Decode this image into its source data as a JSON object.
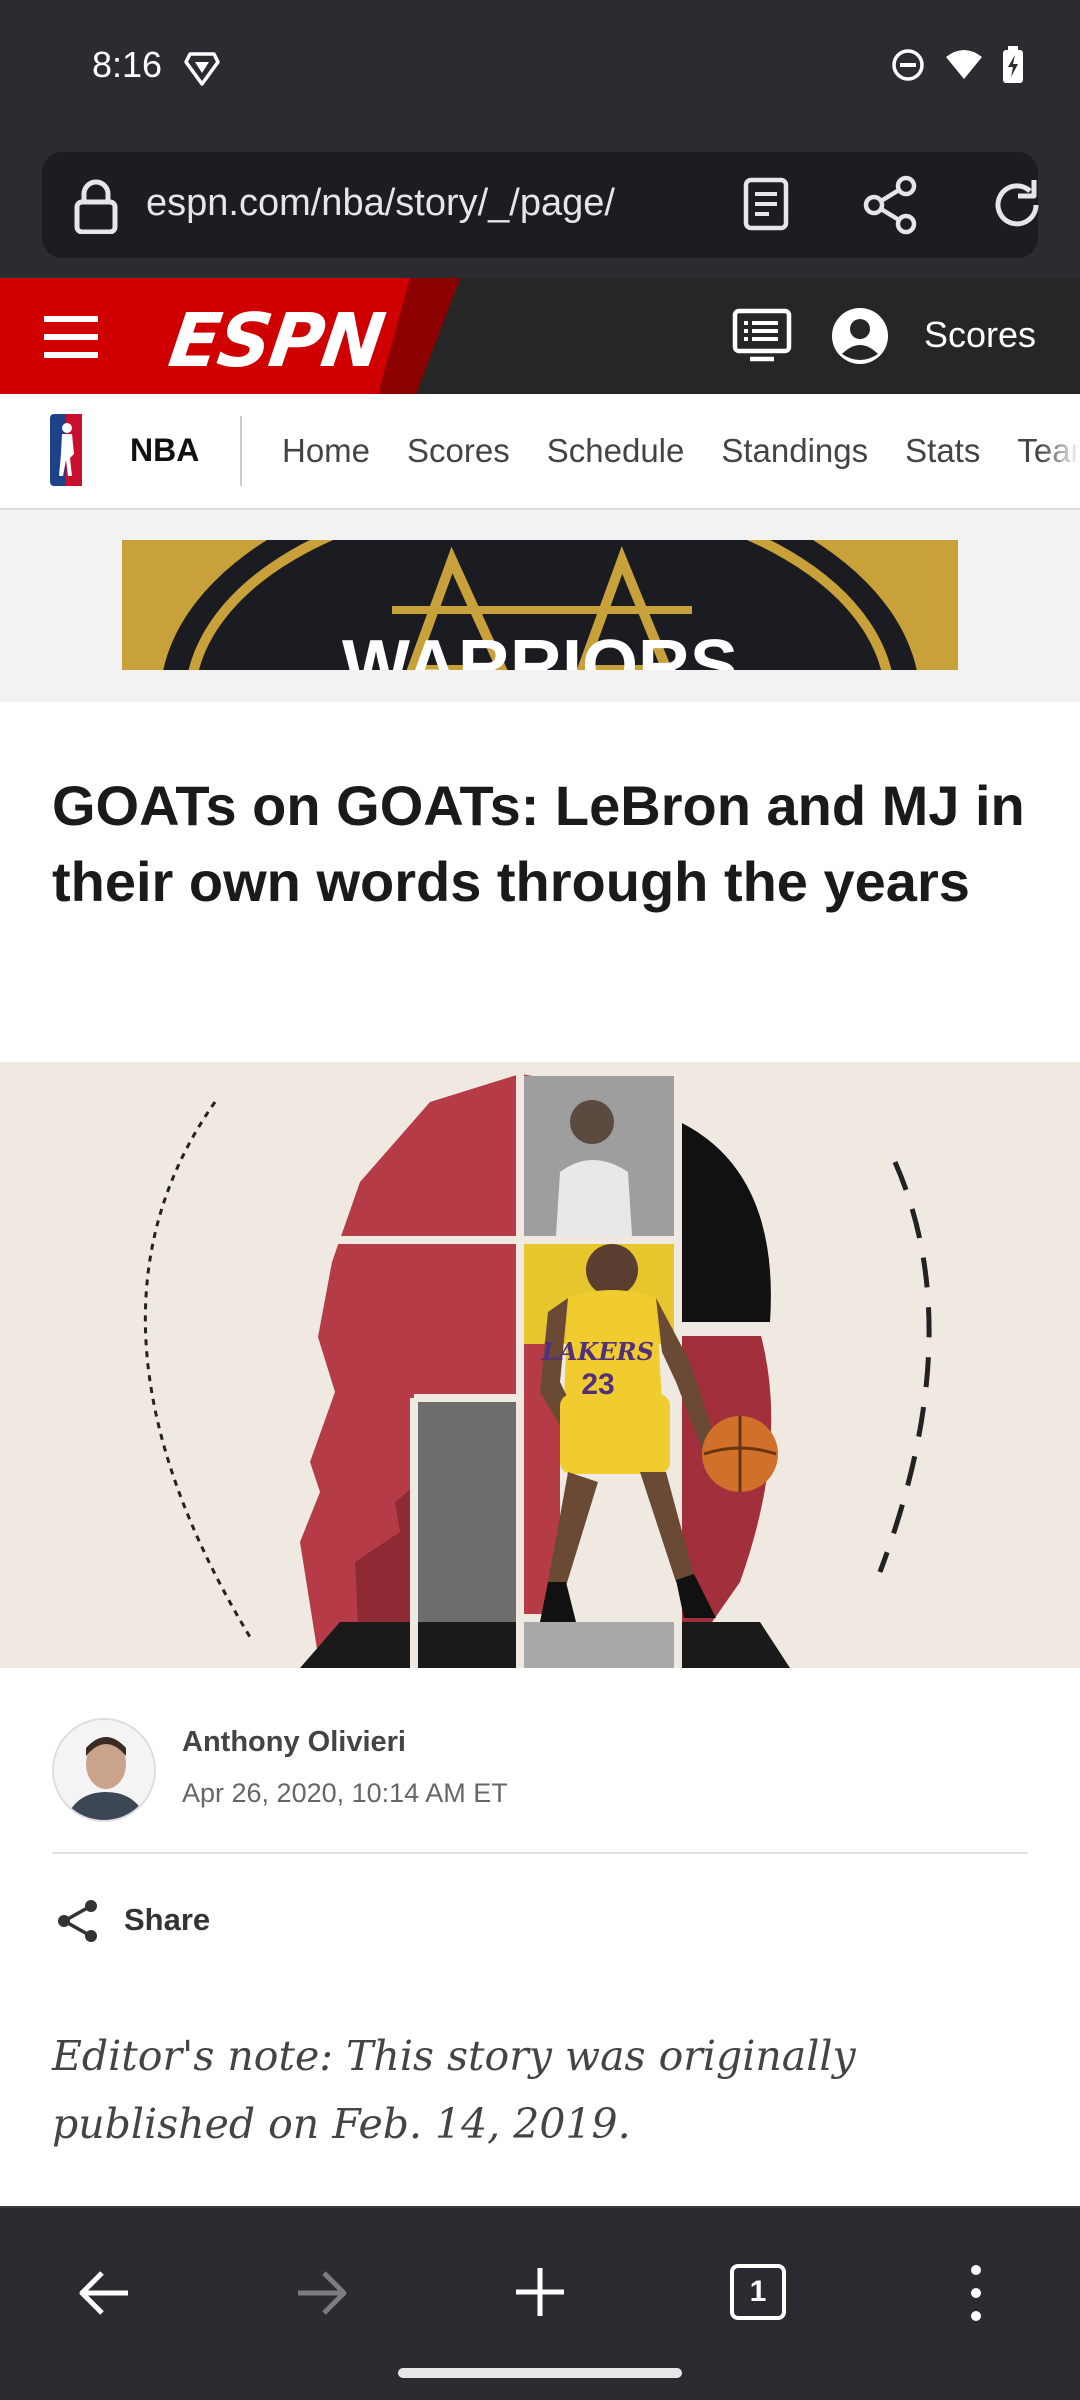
{
  "status_bar": {
    "time": "8:16",
    "icons": [
      "brave-icon",
      "do-not-disturb-icon",
      "wifi-icon",
      "battery-charging-icon"
    ]
  },
  "browser": {
    "url": "espn.com/nba/story/_/page/",
    "icons": [
      "lock-icon",
      "reader-mode-icon",
      "share-icon",
      "reload-icon"
    ]
  },
  "espn_header": {
    "logo": "ESPN",
    "scores_label": "Scores",
    "brand_color": "#d00000"
  },
  "subnav": {
    "section": "NBA",
    "links": [
      "Home",
      "Scores",
      "Schedule",
      "Standings",
      "Stats",
      "Teams"
    ]
  },
  "ad": {
    "text": "WARRIORS"
  },
  "article": {
    "headline": "GOATs on GOATs: LeBron and MJ in their own words through the years",
    "author": "Anthony Olivieri",
    "date": "Apr 26, 2020, 10:14 AM ET",
    "share_label": "Share",
    "editors_note": "Editor's note: This story was originally published on Feb. 14, 2019.",
    "hero_jersey_team": "LAKERS",
    "hero_jersey_number": "23"
  },
  "toolbar": {
    "tab_count": "1",
    "icons": [
      "back-arrow-icon",
      "forward-arrow-icon",
      "new-tab-icon",
      "tab-switcher-icon",
      "more-menu-icon"
    ]
  }
}
